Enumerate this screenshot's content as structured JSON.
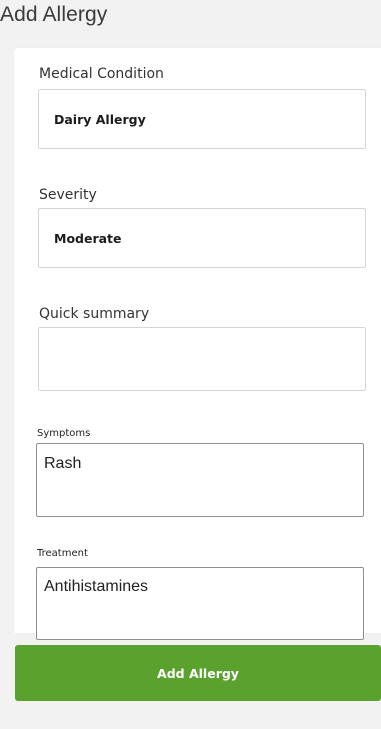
{
  "header": {
    "title": "Add Allergy"
  },
  "form": {
    "medical_condition": {
      "label": "Medical Condition",
      "value": "Dairy Allergy"
    },
    "severity": {
      "label": "Severity",
      "value": "Moderate"
    },
    "quick_summary": {
      "label": "Quick summary",
      "value": ""
    },
    "symptoms": {
      "label": "Symptoms",
      "value": "Rash"
    },
    "treatment": {
      "label": "Treatment",
      "value": "Antihistamines"
    }
  },
  "actions": {
    "submit_label": "Add Allergy"
  },
  "colors": {
    "page_background": "#f2f2f2",
    "submit_button": "#5aa12d",
    "submit_text": "#ffffff"
  }
}
